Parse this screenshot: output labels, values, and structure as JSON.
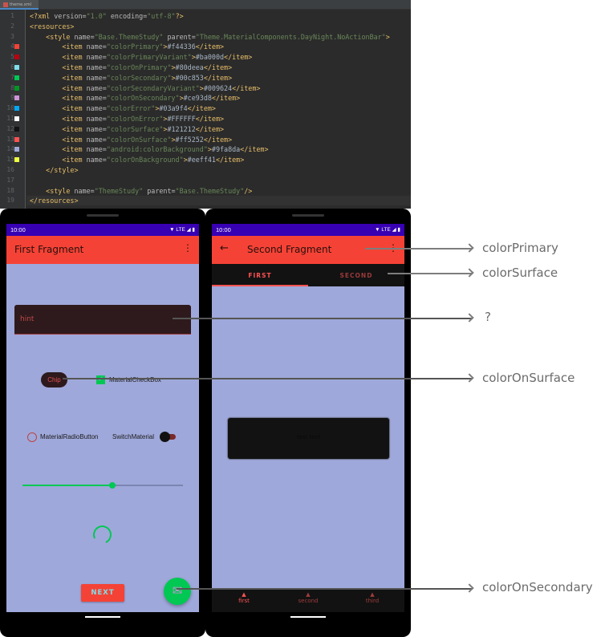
{
  "editor": {
    "tab_label": "theme.xml",
    "lines": [
      {
        "n": "1",
        "seg": [
          [
            "t",
            "<?xml "
          ],
          [
            "a",
            "version="
          ],
          [
            "v",
            "\"1.0\" "
          ],
          [
            "a",
            "encoding="
          ],
          [
            "v",
            "\"utf-8\""
          ],
          [
            "t",
            "?>"
          ]
        ]
      },
      {
        "n": "2",
        "seg": [
          [
            "t",
            "<resources>"
          ]
        ]
      },
      {
        "n": "3",
        "seg": [
          [
            "t",
            "    <style "
          ],
          [
            "a",
            "name="
          ],
          [
            "v",
            "\"Base.ThemeStudy\" "
          ],
          [
            "a",
            "parent="
          ],
          [
            "v",
            "\"Theme.MaterialComponents.DayNight.NoActionBar\""
          ],
          [
            "t",
            ">"
          ]
        ]
      },
      {
        "n": "4",
        "swatch": "#f44336",
        "seg": [
          [
            "t",
            "        <item "
          ],
          [
            "a",
            "name="
          ],
          [
            "v",
            "\"colorPrimary\""
          ],
          [
            "t",
            ">"
          ],
          [
            "x",
            "#f44336"
          ],
          [
            "t",
            "</item>"
          ]
        ]
      },
      {
        "n": "5",
        "swatch": "#ba000d",
        "seg": [
          [
            "t",
            "        <item "
          ],
          [
            "a",
            "name="
          ],
          [
            "v",
            "\"colorPrimaryVariant\""
          ],
          [
            "t",
            ">"
          ],
          [
            "x",
            "#ba000d"
          ],
          [
            "t",
            "</item>"
          ]
        ]
      },
      {
        "n": "6",
        "swatch": "#80deea",
        "seg": [
          [
            "t",
            "        <item "
          ],
          [
            "a",
            "name="
          ],
          [
            "v",
            "\"colorOnPrimary\""
          ],
          [
            "t",
            ">"
          ],
          [
            "x",
            "#80deea"
          ],
          [
            "t",
            "</item>"
          ]
        ]
      },
      {
        "n": "7",
        "swatch": "#00c853",
        "seg": [
          [
            "t",
            "        <item "
          ],
          [
            "a",
            "name="
          ],
          [
            "v",
            "\"colorSecondary\""
          ],
          [
            "t",
            ">"
          ],
          [
            "x",
            "#00c853"
          ],
          [
            "t",
            "</item>"
          ]
        ]
      },
      {
        "n": "8",
        "swatch": "#009624",
        "seg": [
          [
            "t",
            "        <item "
          ],
          [
            "a",
            "name="
          ],
          [
            "v",
            "\"colorSecondaryVariant\""
          ],
          [
            "t",
            ">"
          ],
          [
            "x",
            "#009624"
          ],
          [
            "t",
            "</item>"
          ]
        ]
      },
      {
        "n": "9",
        "swatch": "#ce93d8",
        "seg": [
          [
            "t",
            "        <item "
          ],
          [
            "a",
            "name="
          ],
          [
            "v",
            "\"colorOnSecondary\""
          ],
          [
            "t",
            ">"
          ],
          [
            "x",
            "#ce93d8"
          ],
          [
            "t",
            "</item>"
          ]
        ]
      },
      {
        "n": "10",
        "swatch": "#03a9f4",
        "seg": [
          [
            "t",
            "        <item "
          ],
          [
            "a",
            "name="
          ],
          [
            "v",
            "\"colorError\""
          ],
          [
            "t",
            ">"
          ],
          [
            "x",
            "#03a9f4"
          ],
          [
            "t",
            "</item>"
          ]
        ]
      },
      {
        "n": "11",
        "swatch": "#FFFFFF",
        "seg": [
          [
            "t",
            "        <item "
          ],
          [
            "a",
            "name="
          ],
          [
            "v",
            "\"colorOnError\""
          ],
          [
            "t",
            ">"
          ],
          [
            "x",
            "#FFFFFF"
          ],
          [
            "t",
            "</item>"
          ]
        ]
      },
      {
        "n": "12",
        "swatch": "#121212",
        "seg": [
          [
            "t",
            "        <item "
          ],
          [
            "a",
            "name="
          ],
          [
            "v",
            "\"colorSurface\""
          ],
          [
            "t",
            ">"
          ],
          [
            "x",
            "#121212"
          ],
          [
            "t",
            "</item>"
          ]
        ]
      },
      {
        "n": "13",
        "swatch": "#ff5252",
        "seg": [
          [
            "t",
            "        <item "
          ],
          [
            "a",
            "name="
          ],
          [
            "v",
            "\"colorOnSurface\""
          ],
          [
            "t",
            ">"
          ],
          [
            "x",
            "#ff5252"
          ],
          [
            "t",
            "</item>"
          ]
        ]
      },
      {
        "n": "14",
        "swatch": "#9fa8da",
        "seg": [
          [
            "t",
            "        <item "
          ],
          [
            "a",
            "name="
          ],
          [
            "v",
            "\"android:colorBackground\""
          ],
          [
            "t",
            ">"
          ],
          [
            "x",
            "#9fa8da"
          ],
          [
            "t",
            "</item>"
          ]
        ]
      },
      {
        "n": "15",
        "swatch": "#eeff41",
        "seg": [
          [
            "t",
            "        <item "
          ],
          [
            "a",
            "name="
          ],
          [
            "v",
            "\"colorOnBackground\""
          ],
          [
            "t",
            ">"
          ],
          [
            "x",
            "#eeff41"
          ],
          [
            "t",
            "</item>"
          ]
        ]
      },
      {
        "n": "16",
        "seg": [
          [
            "t",
            "    </style>"
          ]
        ]
      },
      {
        "n": "17",
        "seg": []
      },
      {
        "n": "18",
        "seg": [
          [
            "t",
            "    <style "
          ],
          [
            "a",
            "name="
          ],
          [
            "v",
            "\"ThemeStudy\" "
          ],
          [
            "a",
            "parent="
          ],
          [
            "v",
            "\"Base.ThemeStudy\""
          ],
          [
            "t",
            "/>"
          ]
        ]
      },
      {
        "n": "19",
        "seg": [
          [
            "t",
            "</resources>"
          ]
        ]
      }
    ]
  },
  "phone1": {
    "time": "10:00",
    "network": "LTE",
    "title": "First Fragment",
    "hint": "hint",
    "chip": "Chip",
    "checkbox": "MaterialCheckBox",
    "radio": "MaterialRadioButton",
    "switch": "SwitchMaterial",
    "slider_value": 0.56,
    "next": "NEXT"
  },
  "phone2": {
    "time": "10:00",
    "network": "LTE",
    "title": "Second Fragment",
    "tabs": [
      "FIRST",
      "SECOND"
    ],
    "card_text": "test text",
    "nav": [
      "first",
      "second",
      "third"
    ]
  },
  "annotations": [
    "colorPrimary",
    "colorSurface",
    "?",
    "colorOnSurface",
    "colorOnSecondary"
  ]
}
